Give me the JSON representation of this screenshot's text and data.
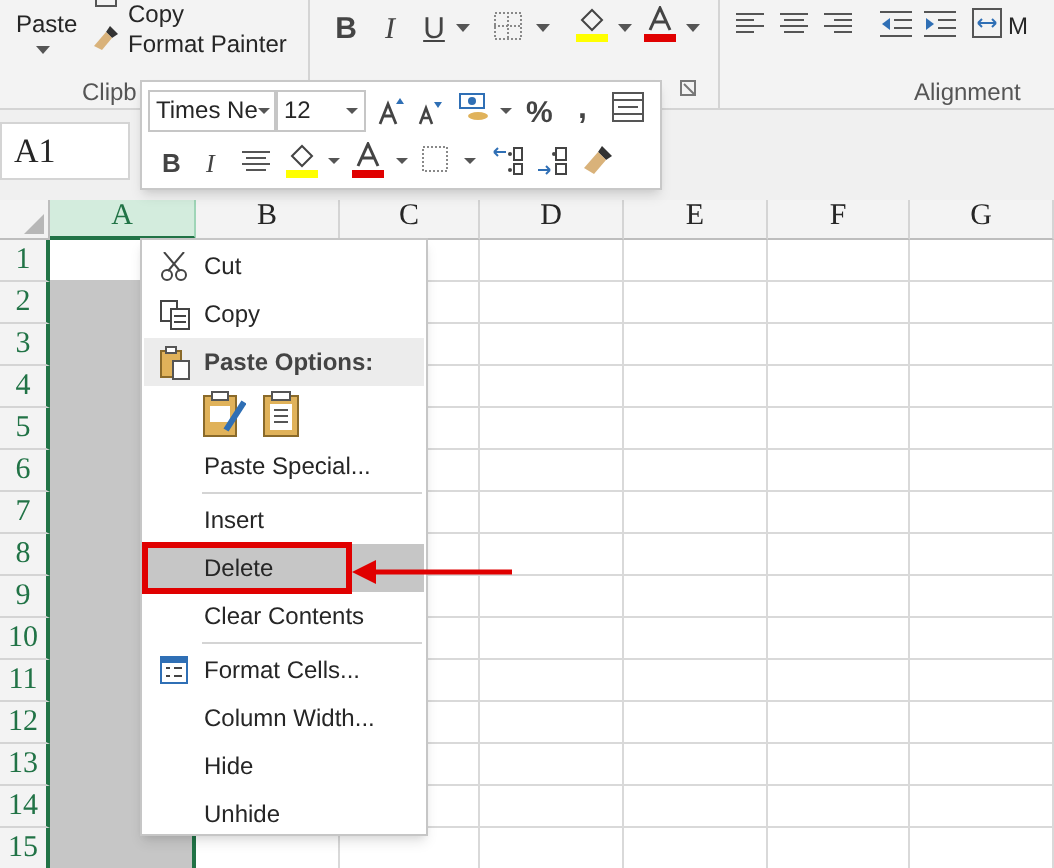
{
  "ribbon": {
    "paste": "Paste",
    "copy": "Copy",
    "format_painter": "Format Painter",
    "clipboard_group": "Clipb",
    "font_buttons": [
      {
        "kind": "bold",
        "label": "B"
      },
      {
        "kind": "italic",
        "label": "I"
      },
      {
        "kind": "underline",
        "label": "U"
      }
    ],
    "alignment_group": "Alignment",
    "merge_partial": "M"
  },
  "name_box": "A1",
  "columns": [
    {
      "label": "A",
      "selected": true
    },
    {
      "label": "B",
      "selected": false
    },
    {
      "label": "C",
      "selected": false
    },
    {
      "label": "D",
      "selected": false
    },
    {
      "label": "E",
      "selected": false
    },
    {
      "label": "F",
      "selected": false
    },
    {
      "label": "G",
      "selected": false
    }
  ],
  "rows": [
    "1",
    "2",
    "3",
    "4",
    "5",
    "6",
    "7",
    "8",
    "9",
    "10",
    "11",
    "12",
    "13",
    "14",
    "15"
  ],
  "mini_toolbar": {
    "font": "Times Ne",
    "size": "12",
    "percent": "%",
    "comma": ",",
    "bold": "B",
    "italic": "I"
  },
  "context_menu": [
    {
      "kind": "item",
      "label": "Cut",
      "selected": false
    },
    {
      "kind": "item",
      "label": "Copy",
      "selected": false
    },
    {
      "kind": "header",
      "label": "Paste Options:"
    },
    {
      "kind": "paste_icons"
    },
    {
      "kind": "item",
      "label": "Paste Special...",
      "selected": false
    },
    {
      "kind": "separator"
    },
    {
      "kind": "item",
      "label": "Insert",
      "selected": false
    },
    {
      "kind": "item",
      "label": "Delete",
      "selected": true
    },
    {
      "kind": "item",
      "label": "Clear Contents",
      "selected": false
    },
    {
      "kind": "separator"
    },
    {
      "kind": "item",
      "label": "Format Cells...",
      "selected": false
    },
    {
      "kind": "item",
      "label": "Column Width...",
      "selected": false
    },
    {
      "kind": "item",
      "label": "Hide",
      "selected": false
    },
    {
      "kind": "item",
      "label": "Unhide",
      "selected": false
    }
  ]
}
